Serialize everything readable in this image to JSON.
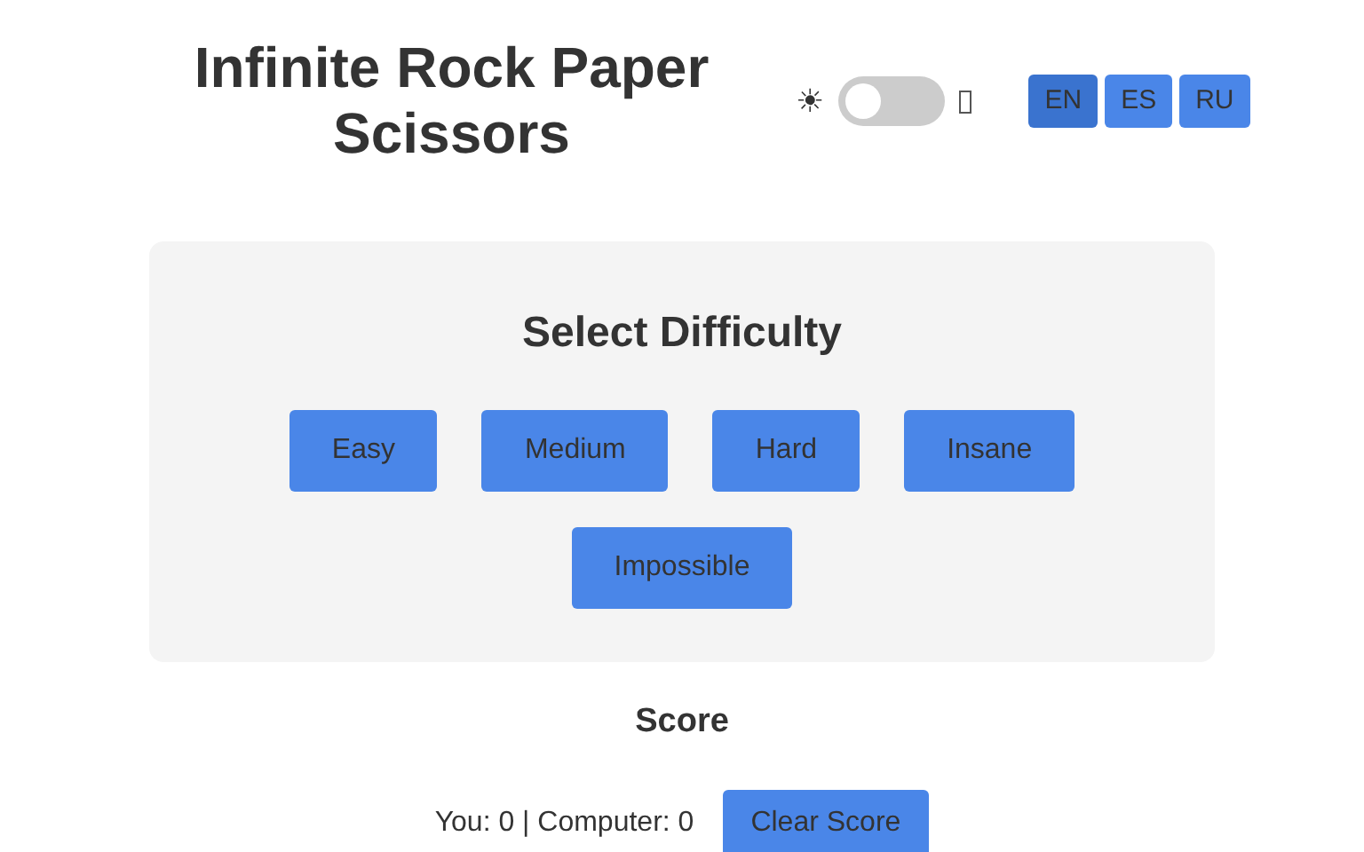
{
  "header": {
    "title": "Infinite Rock Paper Scissors",
    "theme_toggle": {
      "sun_glyph": "☀",
      "on": false
    },
    "languages": [
      {
        "label": "EN",
        "selected": true
      },
      {
        "label": "ES",
        "selected": false
      },
      {
        "label": "RU",
        "selected": false
      }
    ]
  },
  "difficulty": {
    "heading": "Select Difficulty",
    "buttons": [
      "Easy",
      "Medium",
      "Hard",
      "Insane",
      "Impossible"
    ]
  },
  "score": {
    "heading": "Score",
    "text": "You: 0 | Computer: 0",
    "clear_button": "Clear Score"
  }
}
